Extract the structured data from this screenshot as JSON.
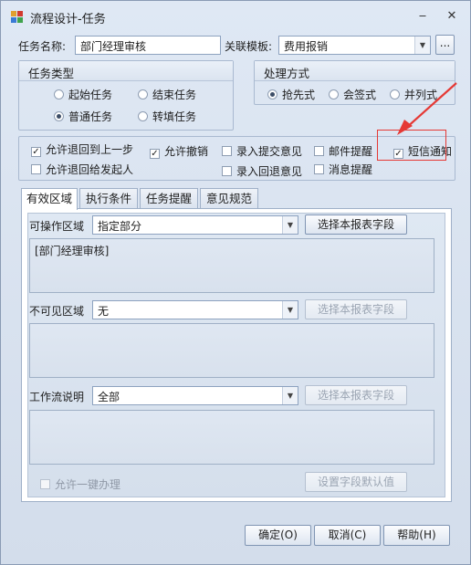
{
  "window": {
    "title": "流程设计-任务",
    "minimize": "‒",
    "close": "✕"
  },
  "header": {
    "task_name_label": "任务名称:",
    "task_name_value": "部门经理审核",
    "template_label": "关联模板:",
    "template_value": "费用报销",
    "ellipsis": "..."
  },
  "task_type": {
    "title": "任务类型",
    "options": [
      {
        "label": "起始任务",
        "checked": false
      },
      {
        "label": "结束任务",
        "checked": false
      },
      {
        "label": "普通任务",
        "checked": true
      },
      {
        "label": "转填任务",
        "checked": false
      }
    ]
  },
  "process_mode": {
    "title": "处理方式",
    "options": [
      {
        "label": "抢先式",
        "checked": true
      },
      {
        "label": "会签式",
        "checked": false
      },
      {
        "label": "并列式",
        "checked": false
      }
    ]
  },
  "options": [
    {
      "label": "允许退回到上一步",
      "checked": true,
      "enabled": true
    },
    {
      "label": "允许撤销",
      "checked": true,
      "enabled": true
    },
    {
      "label": "录入提交意见",
      "checked": false,
      "enabled": true
    },
    {
      "label": "邮件提醒",
      "checked": false,
      "enabled": true
    },
    {
      "label": "短信通知",
      "checked": true,
      "enabled": true
    },
    {
      "label": "允许退回给发起人",
      "checked": false,
      "enabled": true
    },
    {
      "label": "录入回退意见",
      "checked": false,
      "enabled": true
    },
    {
      "label": "消息提醒",
      "checked": false,
      "enabled": true
    }
  ],
  "tabs": [
    "有效区域",
    "执行条件",
    "任务提醒",
    "意见规范"
  ],
  "panel": {
    "operable_label": "可操作区域",
    "operable_value": "指定部分",
    "operable_button": "选择本报表字段",
    "operable_text": "[部门经理审核]",
    "invisible_label": "不可见区域",
    "invisible_value": "无",
    "invisible_button": "选择本报表字段",
    "workflow_label": "工作流说明",
    "workflow_value": "全部",
    "workflow_button": "选择本报表字段",
    "one_click_label": "允许一键办理",
    "default_button": "设置字段默认值"
  },
  "footer": {
    "ok": "确定(O)",
    "cancel": "取消(C)",
    "help": "帮助(H)"
  },
  "colors": {
    "highlight": "#e53935",
    "window_bg": "#d4dde9"
  }
}
